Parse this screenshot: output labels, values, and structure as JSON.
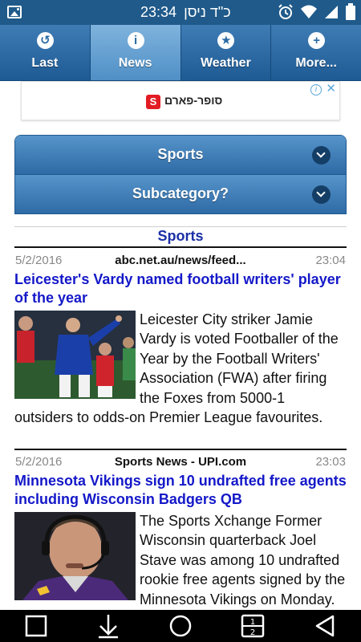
{
  "status_bar": {
    "time": "23:34",
    "date_hebrew": "כ\"ד ניסן"
  },
  "tabs": [
    {
      "label": "Last",
      "icon": "back-arrow-icon",
      "glyph": "↺"
    },
    {
      "label": "News",
      "icon": "info-icon",
      "glyph": "i"
    },
    {
      "label": "Weather",
      "icon": "star-icon",
      "glyph": "★"
    },
    {
      "label": "More...",
      "icon": "plus-icon",
      "glyph": "+"
    }
  ],
  "ad": {
    "text": "סופר-פארם",
    "logo_letter": "S"
  },
  "selectors": {
    "category": "Sports",
    "subcategory": "Subcategory?"
  },
  "section_title": "Sports",
  "articles": [
    {
      "date": "5/2/2016",
      "source": "abc.net.au/news/feed...",
      "time": "23:04",
      "headline": "Leicester's Vardy named football writers' player of the year",
      "body": "Leicester City striker Jamie Vardy is voted Footballer of the Year by the Football Writers' Association (FWA) after firing the Foxes from 5000-1 outsiders to odds-on Premier League favourites."
    },
    {
      "date": "5/2/2016",
      "source": "Sports News - UPI.com",
      "time": "23:03",
      "headline": "Minnesota Vikings sign 10 undrafted free agents including Wisconsin Badgers QB",
      "body": "The Sports Xchange Former Wisconsin quarterback Joel Stave was among 10 undrafted rookie free agents signed by the Minnesota Vikings on Monday."
    }
  ],
  "colors": {
    "status_bar": "#1f5a8a",
    "tab_active": "#6aa6d8",
    "headline": "#1418c8",
    "section_title": "#1a2fa6"
  }
}
